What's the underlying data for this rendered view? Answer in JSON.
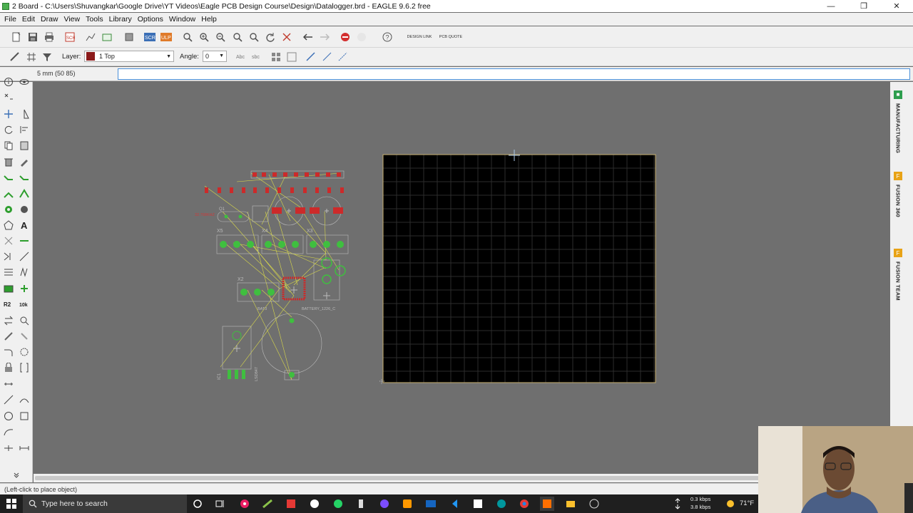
{
  "window": {
    "title": "2 Board - C:\\Users\\Shuvangkar\\Google Drive\\YT Videos\\Eagle PCB Design Course\\Design\\Datalogger.brd - EAGLE 9.6.2 free",
    "minimize": "—",
    "maximize": "❒",
    "close": "✕"
  },
  "menu": [
    "File",
    "Edit",
    "Draw",
    "View",
    "Tools",
    "Library",
    "Options",
    "Window",
    "Help"
  ],
  "toolbar": {
    "design_link_label": "DESIGN LINK",
    "pcb_quote_label": "PCB QUOTE"
  },
  "params": {
    "layer_label": "Layer:",
    "layer_value": "1 Top",
    "layer_color": "#8b1a1a",
    "angle_label": "Angle:",
    "angle_value": "0"
  },
  "command": {
    "coordinate": "5 mm (50 85)",
    "input_value": ""
  },
  "right_panel": {
    "manufacturing": "MANUFACTURING",
    "fusion360": "FUSION 360",
    "fusion_team": "FUSION TEAM"
  },
  "schematic_labels": {
    "x5": "X5",
    "x4": "X4",
    "x3": "X3",
    "x2": "X2",
    "q1": "Q1",
    "bat3": "BAT3",
    "battery": "BATTERY_1226_C",
    "ic1": "IC1",
    "lsd": "LSD847",
    "xtal": "32.768KHZ"
  },
  "statusbar": {
    "text": "(Left-click to place object)"
  },
  "taskbar": {
    "search_placeholder": "Type here to search",
    "net_up": "0.3 kbps",
    "net_down": "3.8 kbps",
    "temperature": "71°F"
  },
  "colors": {
    "board_bg": "#000000",
    "canvas_bg": "#6f6f6f",
    "airwire": "#d9d94a",
    "pad_green": "#3fbf3f",
    "pad_red": "#cc2a2a",
    "outline": "#c8c8c8"
  }
}
